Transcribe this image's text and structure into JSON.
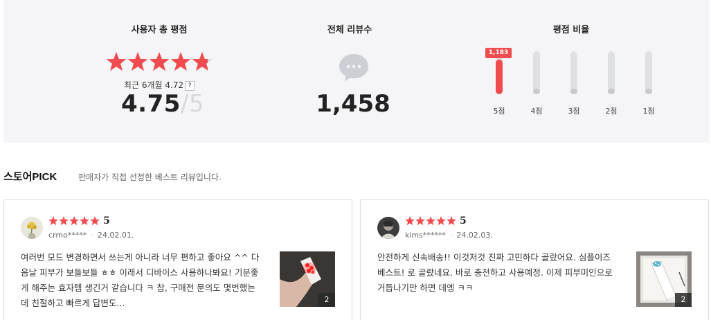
{
  "summary": {
    "user_score_title": "사용자 총 평점",
    "total_reviews_title": "전체 리뷰수",
    "ratio_title": "평점 비율",
    "recent_label": "최근 6개월 4.72",
    "help_mark": "?",
    "score": "4.75",
    "score_max": "/5",
    "rating_stars": 4.75,
    "total_reviews": "1,458",
    "bars": [
      {
        "label": "5점",
        "count": "1,183",
        "fraction": 0.81
      },
      {
        "label": "4점",
        "count": "",
        "fraction": 0.0
      },
      {
        "label": "3점",
        "count": "",
        "fraction": 0.0
      },
      {
        "label": "2점",
        "count": "",
        "fraction": 0.0
      },
      {
        "label": "1점",
        "count": "",
        "fraction": 0.0
      }
    ]
  },
  "pick": {
    "title_ko": "스토어",
    "title_en": "PICK",
    "subtitle": "판매자가 직접 선정한 베스트 리뷰입니다."
  },
  "reviews": [
    {
      "rating": "5",
      "user": "crmo*****",
      "date": "24.02.01.",
      "text": "여러번 모드 변경하면서 쓰는게 아니라 너무 편하고 좋아요 ^^ 다음날 피부가 보들보들 ㅎㅎ 이래서 디바이스 사용하나봐요! 기분좋게 해주는 효자템 생긴거 같습니다 ㅋ 참, 구매전 문의도 몇번했는데 친절하고 빠르게 답변도...",
      "photo_count": "2"
    },
    {
      "rating": "5",
      "user": "kims******",
      "date": "24.02.03.",
      "text": "안전하게 신속배송!! 이것저것 진짜 고민하다 골랐어요. 심플이즈 베스트! 로 골랐네요. 바로 충전하고 사용예정. 이제 피부미인으로 거듭나기만 하면 데엥 ㅋㅋ",
      "photo_count": "2"
    }
  ],
  "colors": {
    "accent": "#f04b4e",
    "panel_bg": "#f5f5f7",
    "bar_track": "#dfe0e4"
  }
}
